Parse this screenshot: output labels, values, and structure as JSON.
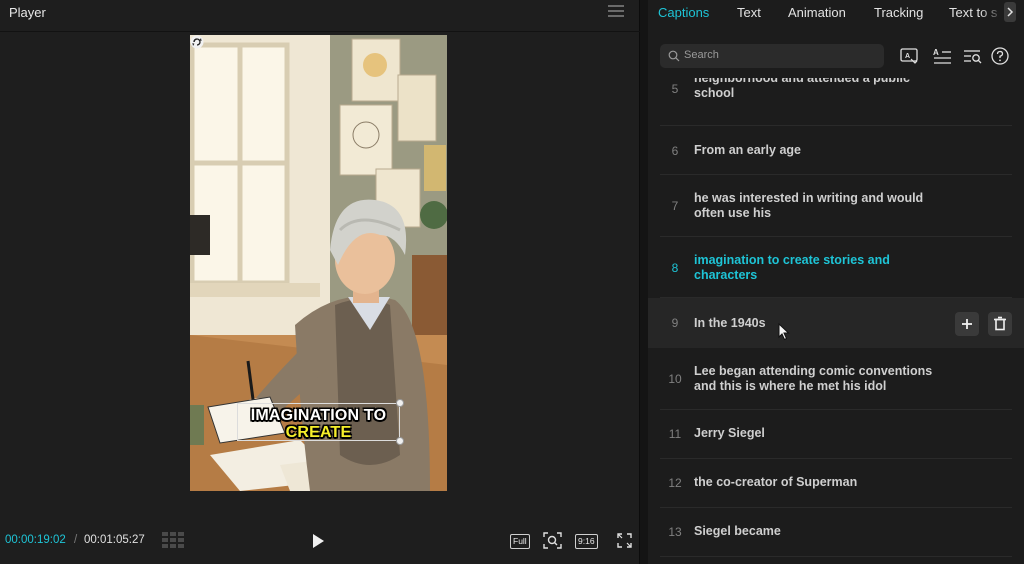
{
  "player": {
    "title": "Player",
    "subtitle_line1": "IMAGINATION TO",
    "subtitle_line2": "CREATE",
    "current_time": "00:00:19:02",
    "separator": "/",
    "total_time": "00:01:05:27",
    "full_label": "Full",
    "ratio_label": "9:16"
  },
  "tabs": [
    "Captions",
    "Text",
    "Animation",
    "Tracking",
    "Text to s"
  ],
  "active_tab": 0,
  "search": {
    "placeholder": "Search"
  },
  "captions": [
    {
      "num": "5",
      "text": "neighborhood and attended a public school"
    },
    {
      "num": "6",
      "text": "From an early age"
    },
    {
      "num": "7",
      "text": "he was interested in writing and would often use his"
    },
    {
      "num": "8",
      "text": "imagination to create stories and characters",
      "state": "active"
    },
    {
      "num": "9",
      "text": "In the 1940s",
      "state": "hover"
    },
    {
      "num": "10",
      "text": "Lee began attending comic conventions and this is where he met his idol"
    },
    {
      "num": "11",
      "text": "Jerry Siegel"
    },
    {
      "num": "12",
      "text": "the co-creator of Superman"
    },
    {
      "num": "13",
      "text": "Siegel became"
    }
  ],
  "colors": {
    "accent": "#1ec4d6",
    "subtitle_highlight": "#f6ef2a"
  }
}
